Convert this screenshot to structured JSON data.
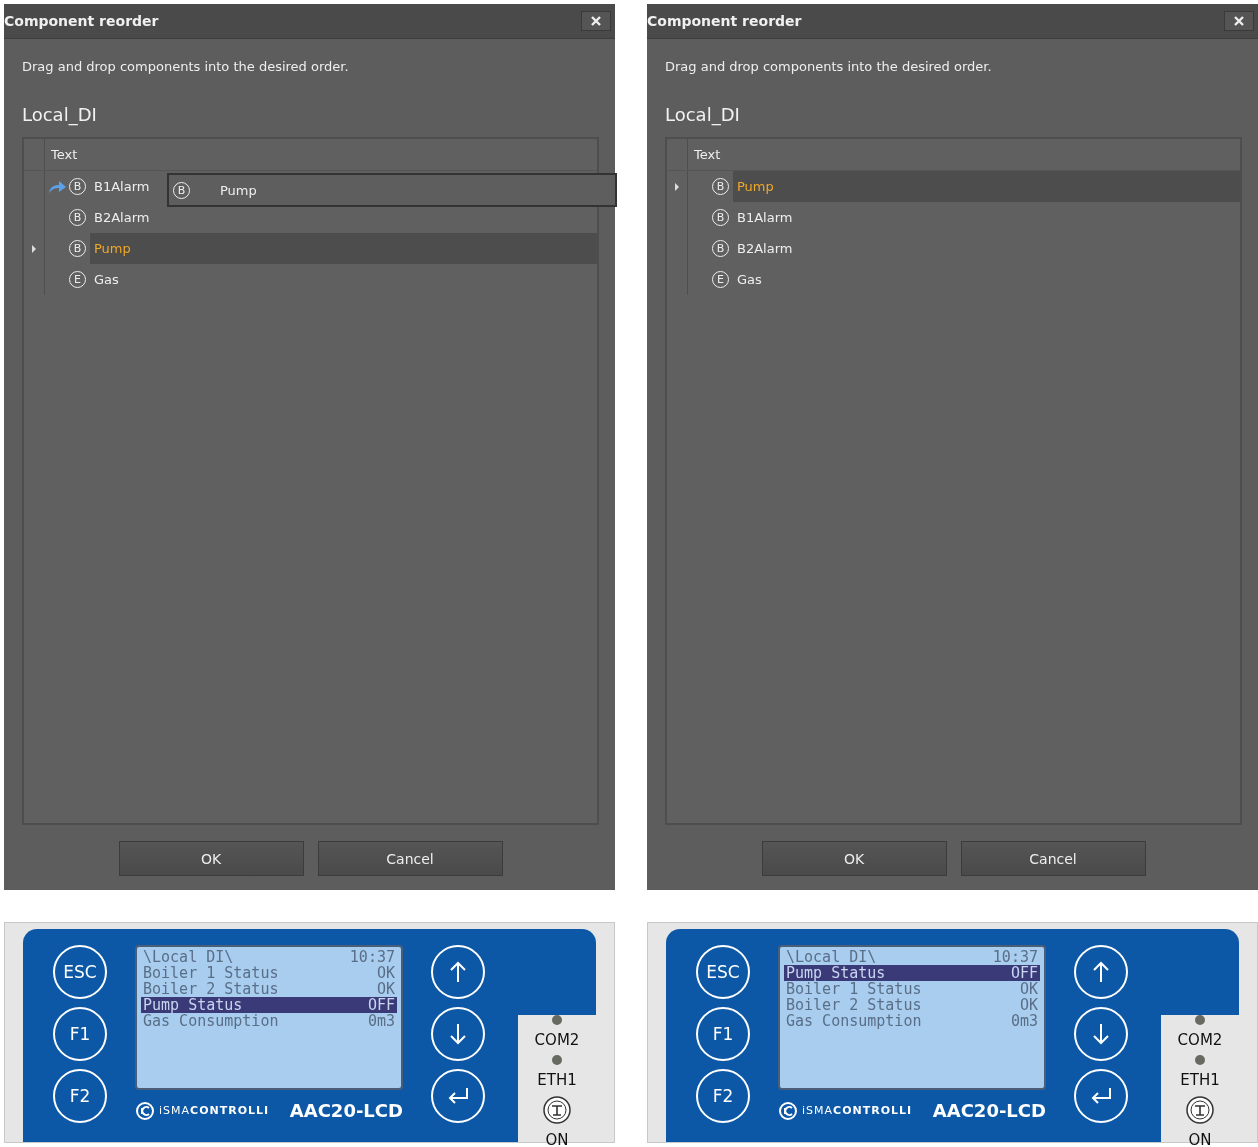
{
  "panels": [
    {
      "dialog": {
        "title": "Component reorder",
        "description": "Drag and drop components into the desired order.",
        "group": "Local_DI",
        "column": "Text",
        "rows": [
          {
            "badge": "B",
            "label": "B1Alarm",
            "selected": false,
            "drop_target": true
          },
          {
            "badge": "B",
            "label": "B2Alarm",
            "selected": false,
            "drop_target": false
          },
          {
            "badge": "B",
            "label": "Pump",
            "selected": true,
            "drop_target": false
          },
          {
            "badge": "E",
            "label": "Gas",
            "selected": false,
            "drop_target": false
          }
        ],
        "drag_ghost": {
          "badge": "B",
          "label": "Pump"
        },
        "buttons": [
          "OK",
          "Cancel"
        ]
      },
      "device": {
        "keys": [
          "ESC",
          "F1",
          "F2"
        ],
        "lcd_header": "\\Local DI\\",
        "lcd_time": "10:37",
        "lcd_lines": [
          {
            "label": "Boiler 1 Status",
            "value": "OK",
            "selected": false
          },
          {
            "label": "Boiler 2 Status",
            "value": "OK",
            "selected": false
          },
          {
            "label": "Pump Status",
            "value": "OFF",
            "selected": true
          },
          {
            "label": "Gas Consumption",
            "value": "0m3",
            "selected": false
          }
        ],
        "brand": "iSMA**CONTROLLI**",
        "model": "AAC20-LCD",
        "leds": [
          "COM2",
          "ETH1",
          "ON"
        ]
      }
    },
    {
      "dialog": {
        "title": "Component reorder",
        "description": "Drag and drop components into the desired order.",
        "group": "Local_DI",
        "column": "Text",
        "rows": [
          {
            "badge": "B",
            "label": "Pump",
            "selected": true,
            "drop_target": false
          },
          {
            "badge": "B",
            "label": "B1Alarm",
            "selected": false,
            "drop_target": false
          },
          {
            "badge": "B",
            "label": "B2Alarm",
            "selected": false,
            "drop_target": false
          },
          {
            "badge": "E",
            "label": "Gas",
            "selected": false,
            "drop_target": false
          }
        ],
        "buttons": [
          "OK",
          "Cancel"
        ]
      },
      "device": {
        "keys": [
          "ESC",
          "F1",
          "F2"
        ],
        "lcd_header": "\\Local DI\\",
        "lcd_time": "10:37",
        "lcd_lines": [
          {
            "label": "Pump Status",
            "value": "OFF",
            "selected": true
          },
          {
            "label": "Boiler 1 Status",
            "value": "OK",
            "selected": false
          },
          {
            "label": "Boiler 2 Status",
            "value": "OK",
            "selected": false
          },
          {
            "label": "Gas Consumption",
            "value": "0m3",
            "selected": false
          }
        ],
        "brand": "iSMA**CONTROLLI**",
        "model": "AAC20-LCD",
        "leds": [
          "COM2",
          "ETH1",
          "ON"
        ]
      }
    }
  ]
}
